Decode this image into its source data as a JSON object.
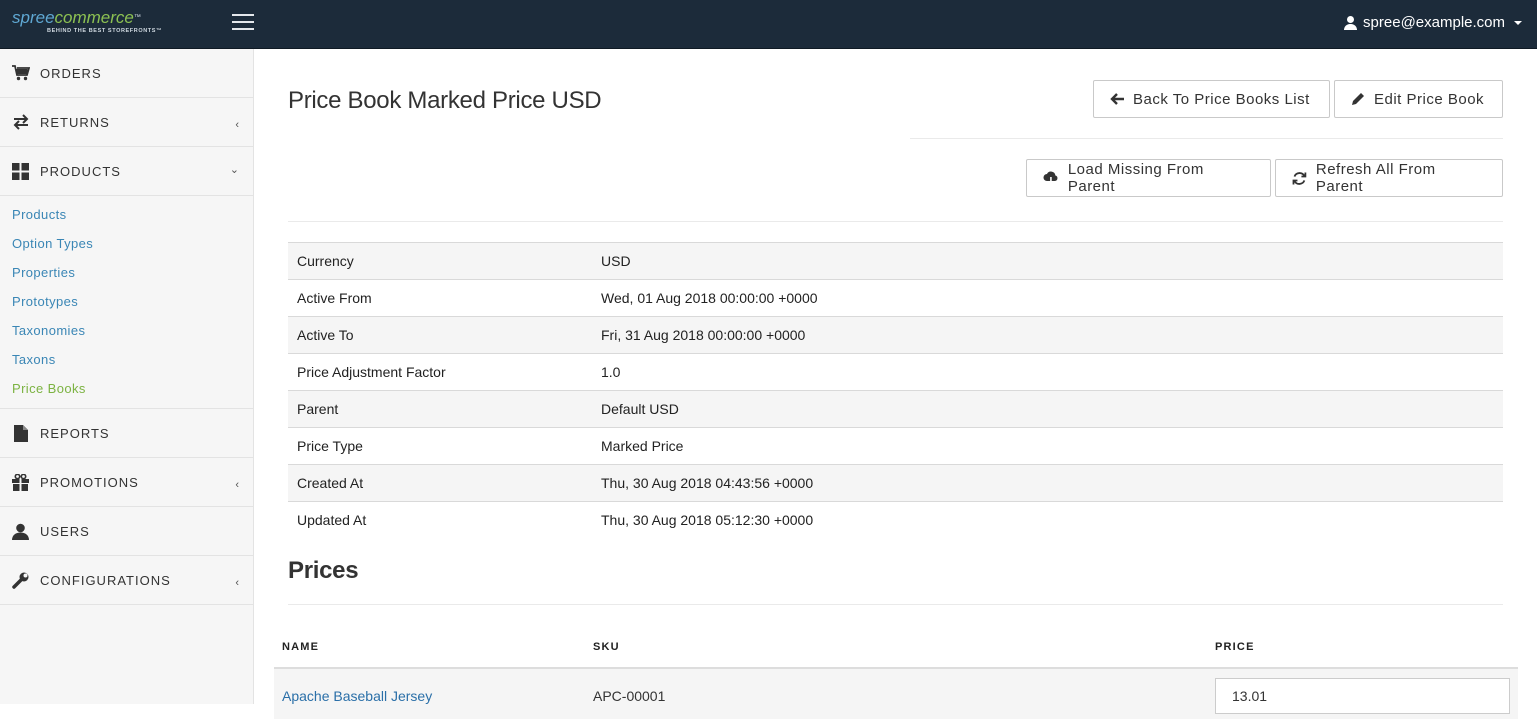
{
  "header": {
    "logo": {
      "part1": "spree",
      "part2": "commerce",
      "tm": "™",
      "tagline": "BEHIND THE BEST STOREFRONTS™"
    },
    "user_email": "spree@example.com"
  },
  "sidebar": {
    "items": [
      {
        "label": "ORDERS",
        "icon": "cart-icon"
      },
      {
        "label": "RETURNS",
        "icon": "exchange-icon",
        "chevron": "‹"
      },
      {
        "label": "PRODUCTS",
        "icon": "grid-icon",
        "chevron": "⌄"
      },
      {
        "label": "REPORTS",
        "icon": "file-icon"
      },
      {
        "label": "PROMOTIONS",
        "icon": "gift-icon",
        "chevron": "‹"
      },
      {
        "label": "USERS",
        "icon": "user-icon"
      },
      {
        "label": "CONFIGURATIONS",
        "icon": "wrench-icon",
        "chevron": "‹"
      }
    ],
    "products_sub": [
      "Products",
      "Option Types",
      "Properties",
      "Prototypes",
      "Taxonomies",
      "Taxons",
      "Price Books"
    ],
    "active_sub": "Price Books"
  },
  "main": {
    "title": "Price Book Marked Price USD",
    "buttons": {
      "back": "Back To Price Books List",
      "edit": "Edit Price Book",
      "load_missing": "Load Missing From Parent",
      "refresh_all": "Refresh All From Parent"
    },
    "details": [
      {
        "key": "Currency",
        "value": "USD"
      },
      {
        "key": "Active From",
        "value": "Wed, 01 Aug 2018 00:00:00 +0000"
      },
      {
        "key": "Active To",
        "value": "Fri, 31 Aug 2018 00:00:00 +0000"
      },
      {
        "key": "Price Adjustment Factor",
        "value": "1.0"
      },
      {
        "key": "Parent",
        "value": "Default USD"
      },
      {
        "key": "Price Type",
        "value": "Marked Price"
      },
      {
        "key": "Created At",
        "value": "Thu, 30 Aug 2018 04:43:56 +0000"
      },
      {
        "key": "Updated At",
        "value": "Thu, 30 Aug 2018 05:12:30 +0000"
      }
    ],
    "prices_title": "Prices",
    "prices_table": {
      "columns": [
        "NAME",
        "SKU",
        "PRICE"
      ],
      "rows": [
        {
          "name": "Apache Baseball Jersey",
          "sku": "APC-00001",
          "price": "13.01"
        }
      ]
    }
  },
  "colors": {
    "topbar": "#1c2b3a",
    "link": "#3a86b5",
    "active": "#7cb342"
  }
}
